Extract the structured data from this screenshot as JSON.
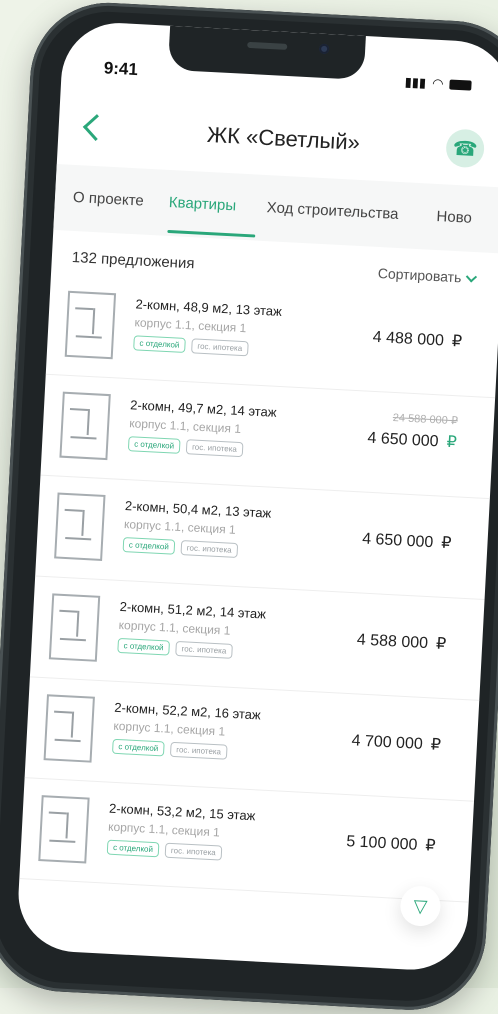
{
  "status": {
    "time": "9:41"
  },
  "header": {
    "title": "ЖК «Светлый»",
    "icons": {
      "back": "chevron-left-icon",
      "call": "phone-call-icon"
    }
  },
  "tabs": [
    {
      "label": "О проекте",
      "active": false
    },
    {
      "label": "Квартиры",
      "active": true
    },
    {
      "label": "Ход строительства",
      "active": false
    },
    {
      "label": "Ново",
      "active": false
    }
  ],
  "list": {
    "count_label": "132 предложения",
    "sort_label": "Сортировать",
    "badges": {
      "finish": "с отделкой",
      "mortgage": "гос. ипотека"
    },
    "items": [
      {
        "title": "2-комн, 48,9 м2, 13 этаж",
        "subtitle": "корпус 1.1, секция 1",
        "price": "4 488 000",
        "currency": "₽",
        "old_price": ""
      },
      {
        "title": "2-комн, 49,7 м2, 14 этаж",
        "subtitle": "корпус 1.1, секция 1",
        "price": "4 650 000",
        "currency": "₽",
        "old_price": "24 588 000 ₽"
      },
      {
        "title": "2-комн, 50,4 м2, 13 этаж",
        "subtitle": "корпус 1.1, секция 1",
        "price": "4 650 000",
        "currency": "₽",
        "old_price": ""
      },
      {
        "title": "2-комн, 51,2 м2, 14 этаж",
        "subtitle": "корпус 1.1, секция 1",
        "price": "4 588 000",
        "currency": "₽",
        "old_price": ""
      },
      {
        "title": "2-комн, 52,2 м2, 16 этаж",
        "subtitle": "корпус 1.1, секция 1",
        "price": "4 700 000",
        "currency": "₽",
        "old_price": ""
      },
      {
        "title": "2-комн, 53,2 м2, 15 этаж",
        "subtitle": "корпус 1.1, секция 1",
        "price": "5 100 000",
        "currency": "₽",
        "old_price": ""
      }
    ]
  },
  "colors": {
    "accent": "#2aa77a"
  }
}
